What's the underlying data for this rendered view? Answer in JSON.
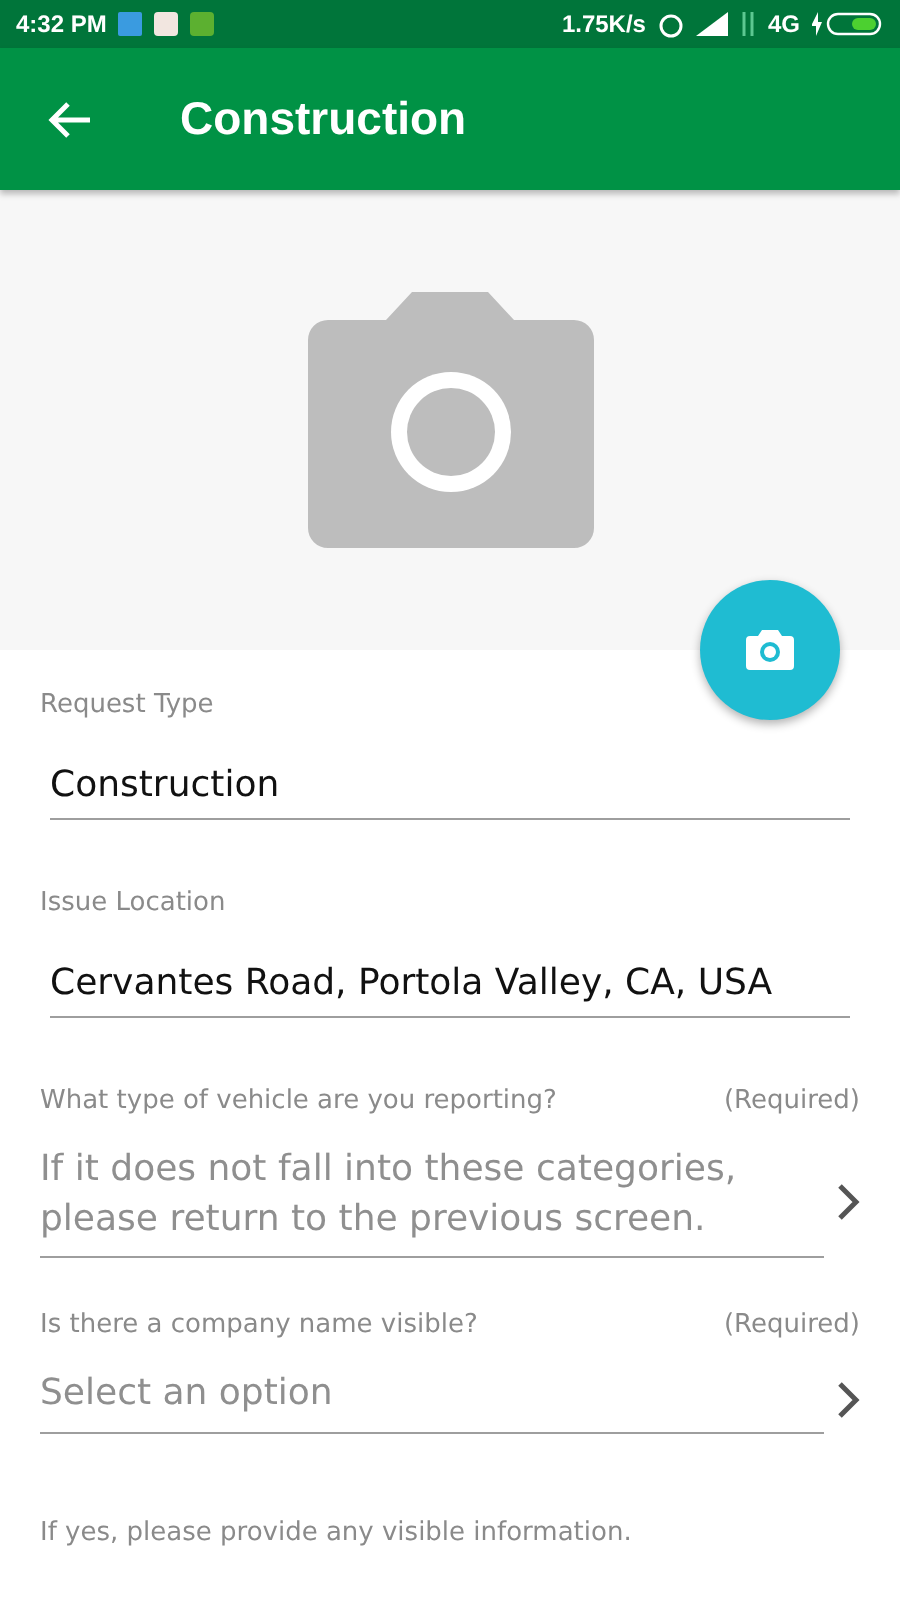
{
  "status_bar": {
    "time": "4:32 PM",
    "speed": "1.75K/s",
    "network": "4G"
  },
  "toolbar": {
    "title": "Construction"
  },
  "photo": {
    "kind": "placeholder"
  },
  "fields": [
    {
      "kind": "text",
      "label": "Request Type",
      "value": "Construction"
    },
    {
      "kind": "text",
      "label": "Issue Location",
      "value": "Cervantes Road, Portola Valley, CA, USA"
    },
    {
      "kind": "select",
      "label": "What type of vehicle are you reporting?",
      "required": "(Required)",
      "placeholder": "If it does not fall into these categories, please return to the previous screen."
    },
    {
      "kind": "select",
      "label": "Is there a company name visible?",
      "required": "(Required)",
      "placeholder": "Select an option"
    }
  ],
  "hint": "If yes, please provide any visible information."
}
